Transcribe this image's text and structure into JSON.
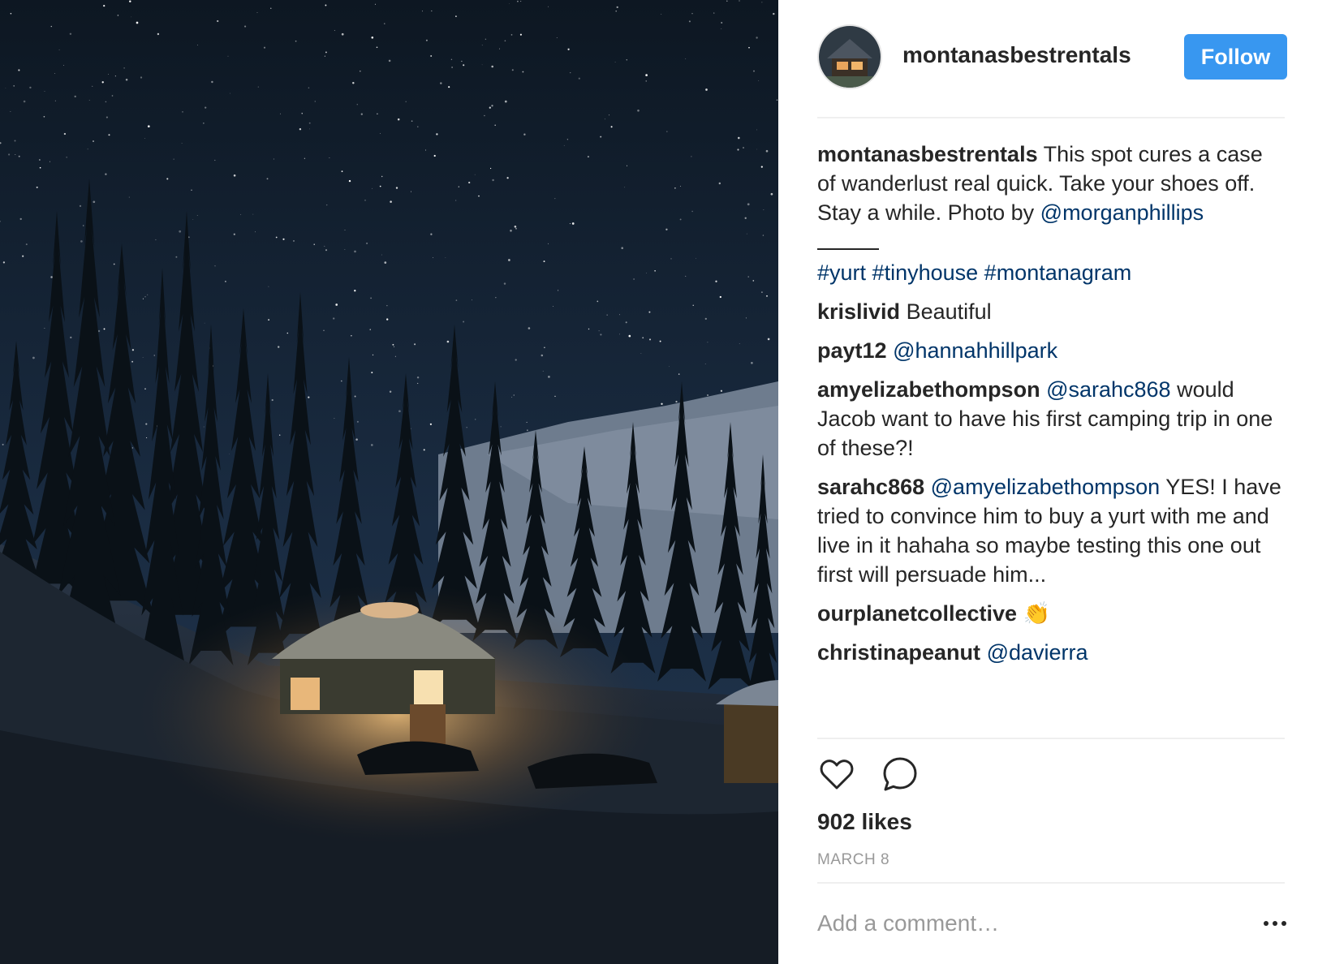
{
  "header": {
    "username": "montanasbestrentals",
    "follow_label": "Follow",
    "avatar_icon": "cabin-avatar-icon"
  },
  "caption": {
    "username": "montanasbestrentals",
    "text": " This spot cures a case of wanderlust real quick. Take your shoes off. Stay a while. Photo by ",
    "mention": "@morganphillips",
    "hashtags": [
      "#yurt",
      "#tinyhouse",
      "#montanagram"
    ]
  },
  "comments": [
    {
      "user": "krislivid",
      "text": " Beautiful"
    },
    {
      "user": "payt12",
      "mention": "@hannahhillpark",
      "text": ""
    },
    {
      "user": "amyelizabethompson",
      "mention": "@sarahc868",
      "text": " would Jacob want to have his first camping trip in one of these?!"
    },
    {
      "user": "sarahc868",
      "mention": "@amyelizabethompson",
      "text": " YES! I have tried to convince him to buy a yurt with me and live in it hahaha so maybe testing this one out first will persuade him..."
    },
    {
      "user": "ourplanetcollective",
      "text": " 👏"
    },
    {
      "user": "christinapeanut",
      "mention": "@davierra",
      "text": ""
    }
  ],
  "actions": {
    "like_icon": "heart-icon",
    "comment_icon": "comment-bubble-icon"
  },
  "likes": "902 likes",
  "date": "MARCH 8",
  "add_comment_placeholder": "Add a comment…",
  "more_icon": "more-options-icon",
  "colors": {
    "follow_button": "#3897f0",
    "link": "#003569",
    "text": "#262626",
    "muted": "#999999"
  }
}
